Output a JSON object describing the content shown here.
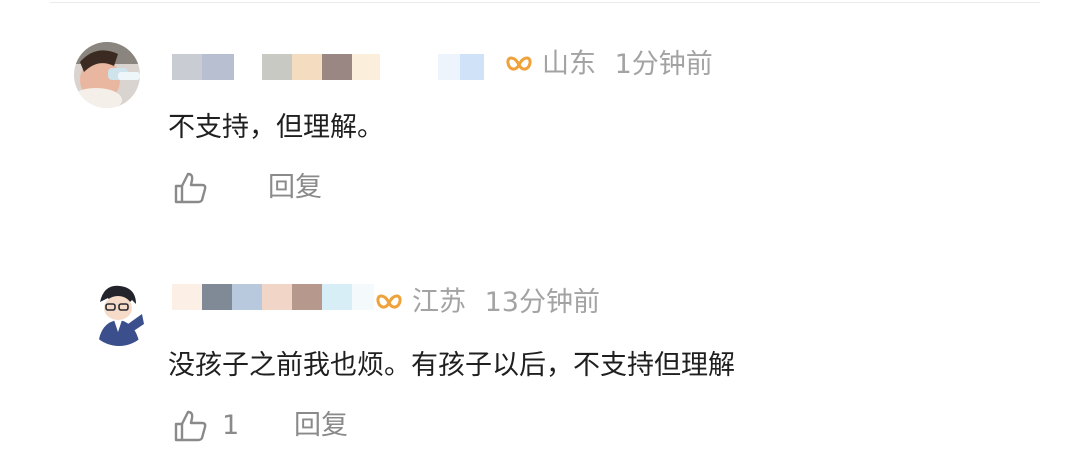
{
  "comments": [
    {
      "location": "山东",
      "time": "1分钟前",
      "text": "不支持，但理解。",
      "like_count": "",
      "reply_label": "回复",
      "avatar_icon": "child-drinking-avatar"
    },
    {
      "location": "江苏",
      "time": "13分钟前",
      "text": "没孩子之前我也烦。有孩子以后，不支持但理解",
      "like_count": "1",
      "reply_label": "回复",
      "avatar_icon": "cartoon-boy-avatar"
    }
  ],
  "icons": {
    "badge": "butterfly-badge-icon",
    "like": "thumbs-up-icon"
  },
  "colors": {
    "badge": "#f0a23a",
    "meta_text": "#a3a3a3",
    "action_text": "#8a8a8a"
  }
}
